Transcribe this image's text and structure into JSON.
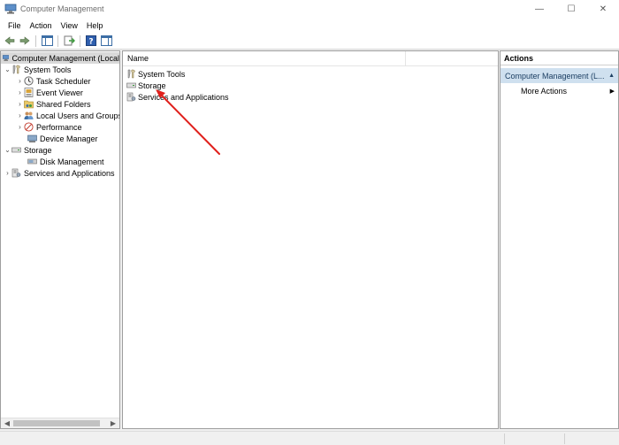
{
  "window": {
    "title": "Computer Management",
    "minimize": "—",
    "maximize": "☐",
    "close": "✕"
  },
  "menu": [
    "File",
    "Action",
    "View",
    "Help"
  ],
  "tree": {
    "root": "Computer Management (Local",
    "system_tools": "System Tools",
    "task_scheduler": "Task Scheduler",
    "event_viewer": "Event Viewer",
    "shared_folders": "Shared Folders",
    "local_users": "Local Users and Groups",
    "performance": "Performance",
    "device_manager": "Device Manager",
    "storage": "Storage",
    "disk_management": "Disk Management",
    "services": "Services and Applications"
  },
  "list": {
    "column_name": "Name",
    "items": [
      "System Tools",
      "Storage",
      "Services and Applications"
    ]
  },
  "actions": {
    "title": "Actions",
    "section": "Computer Management (L...",
    "more_actions": "More Actions"
  },
  "colors": {
    "accent": "#cfe0ef",
    "annotation_arrow": "#e0201c"
  }
}
